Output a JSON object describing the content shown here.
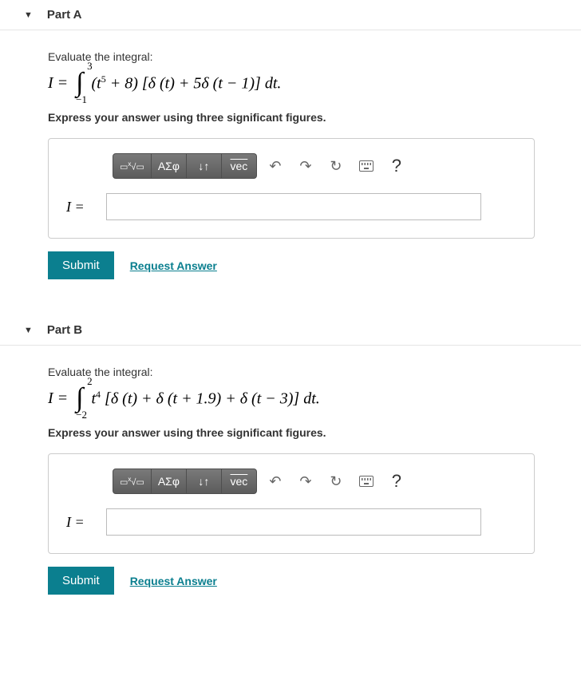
{
  "parts": [
    {
      "title": "Part A",
      "prompt": "Evaluate the integral:",
      "math": {
        "prefix": "I =",
        "upper": "3",
        "lower": "−1",
        "body_html": "(<i>t</i><sup>5</sup> + 8) [<i>δ</i> (<i>t</i>) + 5<i>δ</i> (<i>t</i> − 1)] <i>dt</i>."
      },
      "instruction": "Express your answer using three significant figures.",
      "input_label": "I =",
      "input_value": "",
      "submit": "Submit",
      "request": "Request Answer"
    },
    {
      "title": "Part B",
      "prompt": "Evaluate the integral:",
      "math": {
        "prefix": "I =",
        "upper": "2",
        "lower": "−2",
        "body_html": "<i>t</i><sup>4</sup> [<i>δ</i> (<i>t</i>) + <i>δ</i> (<i>t</i> + 1.9) + <i>δ</i> (<i>t</i> − 3)] <i>dt</i>."
      },
      "instruction": "Express your answer using three significant figures.",
      "input_label": "I =",
      "input_value": "",
      "submit": "Submit",
      "request": "Request Answer"
    }
  ],
  "toolbar": {
    "templates": "templates",
    "greek": "ΑΣφ",
    "subsup": "subsup",
    "vec": "vec",
    "undo": "undo",
    "redo": "redo",
    "reset": "reset",
    "keyboard": "keyboard",
    "help": "?"
  }
}
